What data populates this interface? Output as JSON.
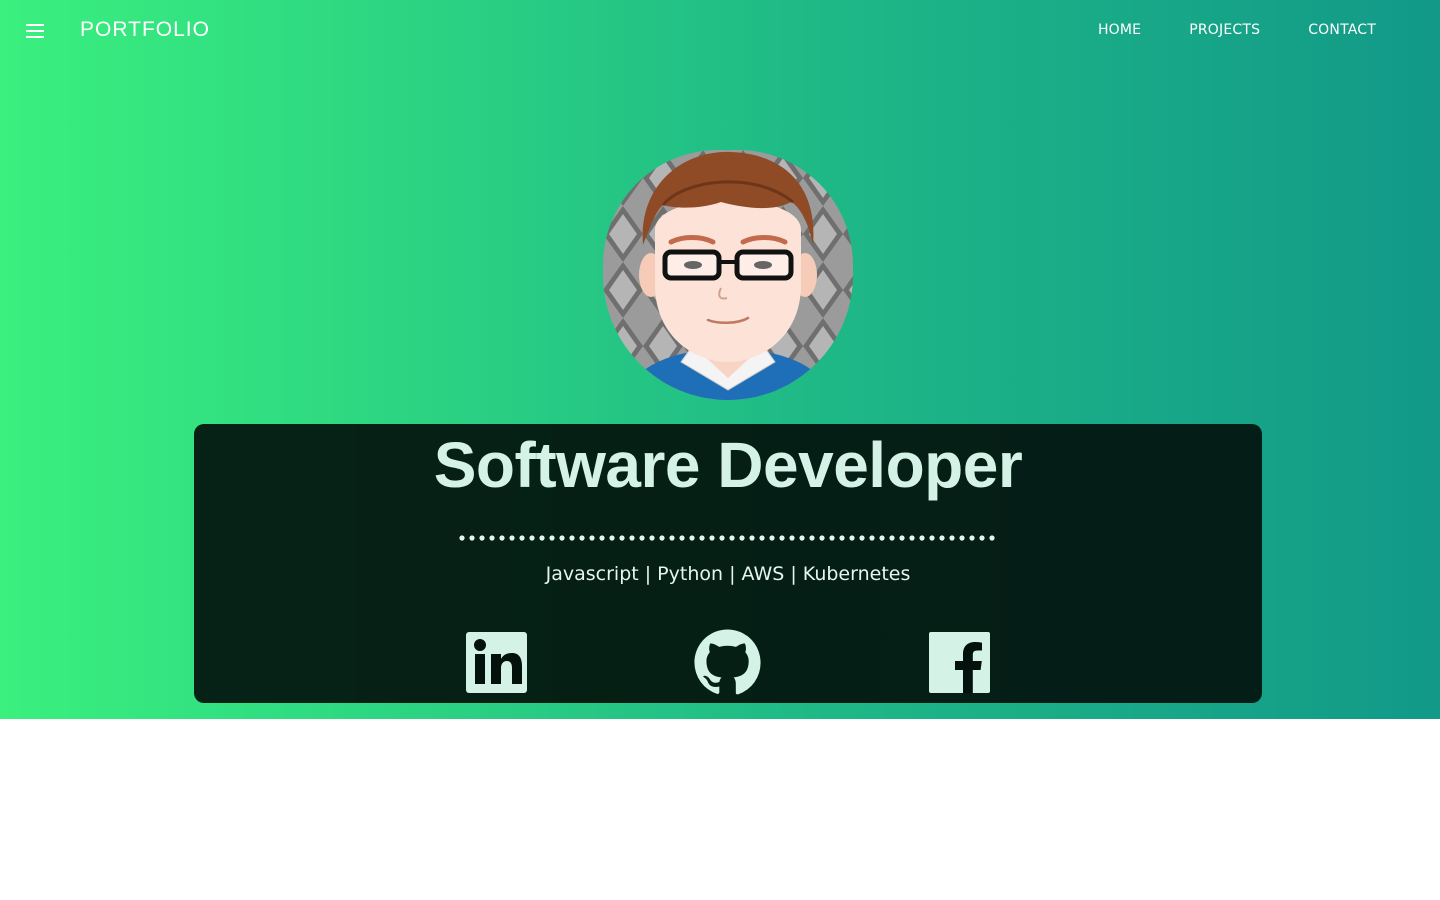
{
  "navbar": {
    "brand": "PORTFOLIO",
    "menu_icon": "hamburger-menu-icon",
    "links": [
      {
        "label": "HOME"
      },
      {
        "label": "PROJECTS"
      },
      {
        "label": "CONTACT"
      }
    ]
  },
  "hero": {
    "avatar_icon": "developer-avatar-illustration",
    "title": "Software Developer",
    "skills": "Javascript | Python | AWS | Kubernetes",
    "social": [
      {
        "name": "linkedin-icon"
      },
      {
        "name": "github-icon"
      },
      {
        "name": "facebook-icon"
      }
    ]
  },
  "colors": {
    "gradient_start": "#3af07e",
    "gradient_end": "#129989",
    "card_background": "#03120d",
    "title_text": "#d5f2e6"
  }
}
